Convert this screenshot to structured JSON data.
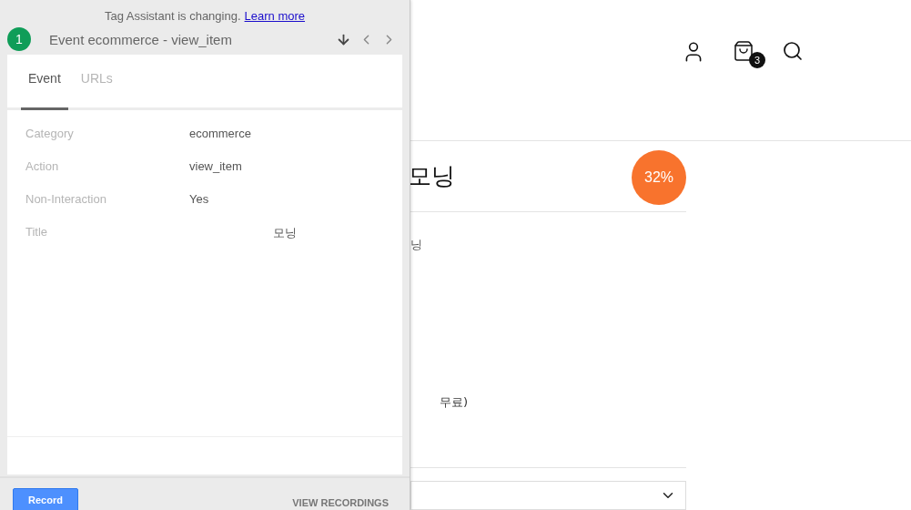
{
  "banner": {
    "text": "Tag Assistant is changing.",
    "link": "Learn more"
  },
  "event": {
    "number": "1",
    "title": "Event ecommerce - view_item"
  },
  "tabs": [
    {
      "label": "Event",
      "selected": true
    },
    {
      "label": "URLs",
      "selected": false
    }
  ],
  "fields": [
    {
      "label": "Category",
      "value": "ecommerce"
    },
    {
      "label": "Action",
      "value": "view_item"
    },
    {
      "label": "Non-Interaction",
      "value": "Yes"
    },
    {
      "label": "Title",
      "value": "모닝"
    }
  ],
  "footer": {
    "record": "Record",
    "recordings": "VIEW RECORDINGS"
  },
  "page": {
    "cart_count": "3",
    "product_title": "모닝",
    "discount": "32%",
    "subtitle": "닝",
    "shipping": "무료)"
  }
}
